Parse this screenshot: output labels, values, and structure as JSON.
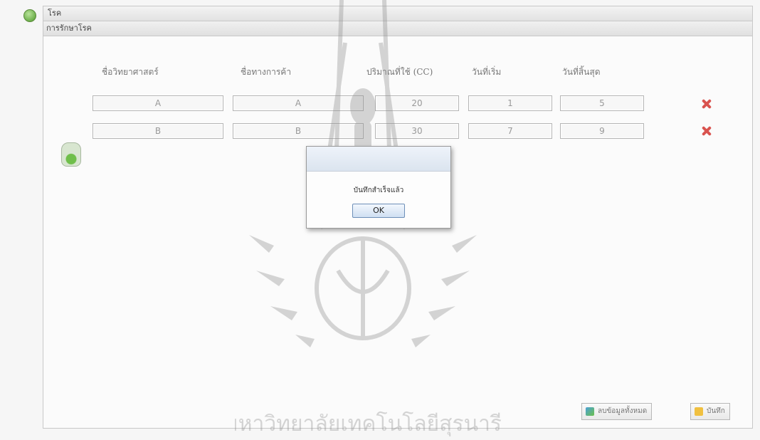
{
  "header": {
    "title": "โรค"
  },
  "subheader": {
    "title": "การรักษาโรค"
  },
  "table": {
    "columns": [
      "ชื่อวิทยาศาสตร์",
      "ชื่อทางการค้า",
      "ปริมาณที่ใช้ (CC)",
      "วันที่เริ่ม",
      "วันที่สิ้นสุด"
    ],
    "rows": [
      [
        "A",
        "A",
        "20",
        "1",
        "5"
      ],
      [
        "B",
        "B",
        "30",
        "7",
        "9"
      ]
    ]
  },
  "dialog": {
    "message": "บันทึกสำเร็จแล้ว",
    "ok_label": "OK"
  },
  "footer": {
    "clear_label": "ลบข้อมูลทั้งหมด",
    "save_label": "บันทึก"
  },
  "watermark": {
    "caption": "มหาวิทยาลัยเทคโนโลยีสุรนารี"
  },
  "colors": {
    "delete": "#d9534f",
    "dialog_border": "#9a9a9a",
    "ok_button": "#cfdff2"
  },
  "icons": {
    "header": "globe-icon",
    "row_delete": "delete-x-icon",
    "add_row": "add-drug-icon",
    "clear_button": "clear-icon",
    "save_button": "save-icon"
  }
}
